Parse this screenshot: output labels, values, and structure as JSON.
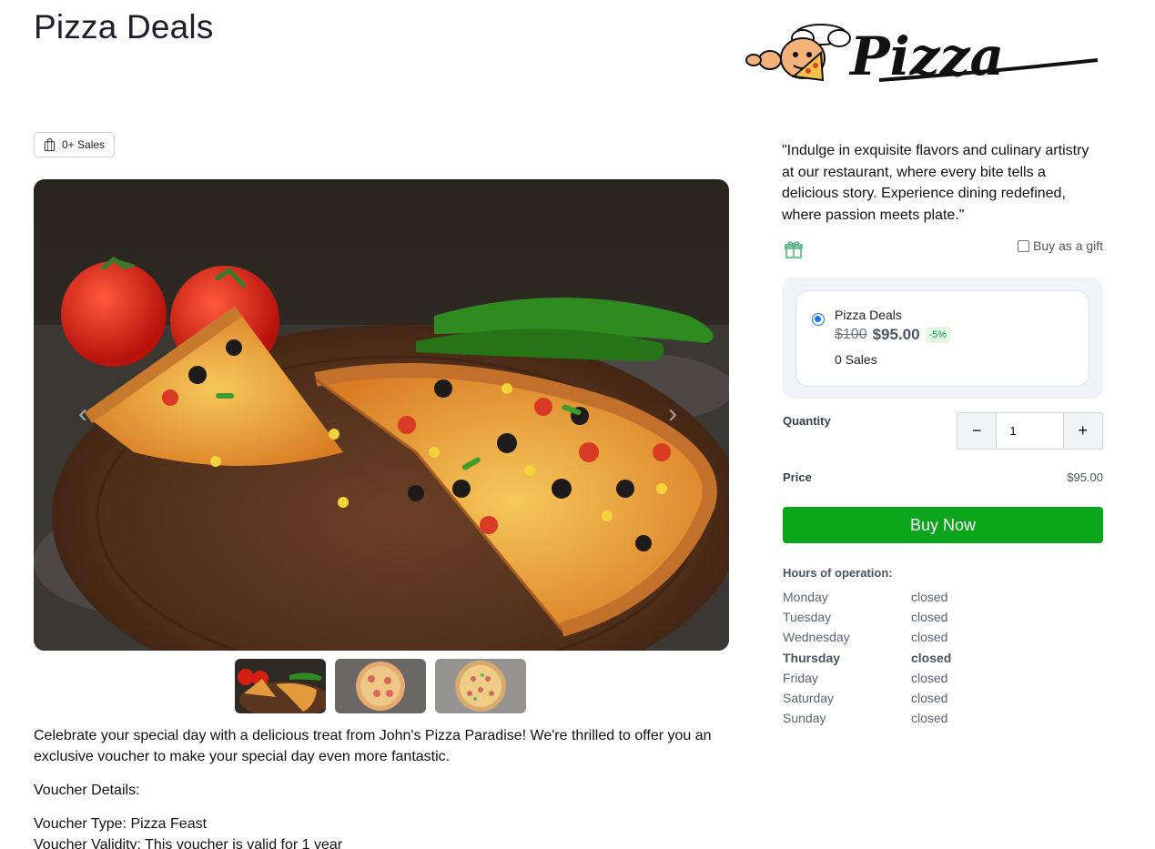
{
  "page": {
    "title": "Pizza Deals"
  },
  "logo": {
    "alt": "Pizza",
    "text": "Pizza"
  },
  "sales_badge": {
    "label": "0+ Sales"
  },
  "gallery": {
    "thumbnails": [
      "thumbnail-1",
      "thumbnail-2",
      "thumbnail-3"
    ],
    "active_index": 0
  },
  "description": {
    "intro": "Celebrate your special day with a delicious treat from John's Pizza Paradise! We're thrilled to offer you an exclusive voucher to make your special day even more fantastic.",
    "details_heading": "Voucher Details:",
    "voucher_type": "Voucher Type: Pizza Feast",
    "voucher_validity": "Voucher Validity: This voucher is valid for 1 year"
  },
  "quote": "\"Indulge in exquisite flavors and culinary artistry at our restaurant, where every bite tells a delicious story. Experience dining redefined, where passion meets plate.\"",
  "gift": {
    "label": "Buy as a gift",
    "checked": false
  },
  "option": {
    "name": "Pizza Deals",
    "old_price": "$100",
    "new_price": "$95.00",
    "discount": "-5%",
    "sales": "0 Sales",
    "selected": true
  },
  "quantity": {
    "label": "Quantity",
    "value": "1",
    "minus": "−",
    "plus": "+"
  },
  "price": {
    "label": "Price",
    "value": "$95.00"
  },
  "buy_button": {
    "label": "Buy Now",
    "color": "#0aa51a"
  },
  "hours": {
    "title": "Hours of operation:",
    "rows": [
      {
        "day": "Monday",
        "status": "closed"
      },
      {
        "day": "Tuesday",
        "status": "closed"
      },
      {
        "day": "Wednesday",
        "status": "closed"
      },
      {
        "day": "Thursday",
        "status": "closed"
      },
      {
        "day": "Friday",
        "status": "closed"
      },
      {
        "day": "Saturday",
        "status": "closed"
      },
      {
        "day": "Sunday",
        "status": "closed"
      }
    ],
    "today_index": 3
  }
}
